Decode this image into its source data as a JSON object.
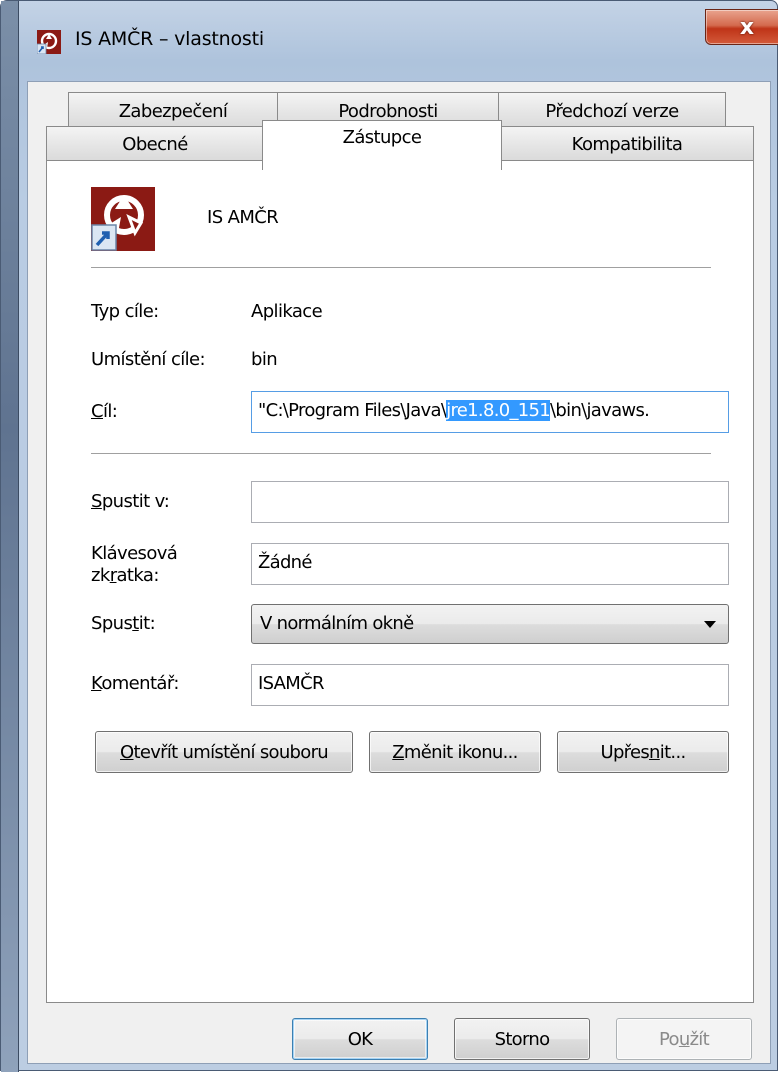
{
  "window": {
    "title": "IS AMČR – vlastnosti",
    "close_label": "x"
  },
  "tabs": {
    "row1": [
      {
        "label": "Zabezpečení"
      },
      {
        "label": "Podrobnosti"
      },
      {
        "label": "Předchozí verze"
      }
    ],
    "row2": [
      {
        "label": "Obecné"
      },
      {
        "label": "Zástupce",
        "active": true
      },
      {
        "label": "Kompatibilita"
      }
    ]
  },
  "shortcut": {
    "app_name": "IS AMČR",
    "icon": "app-shortcut-icon",
    "target_type_label": "Typ cíle:",
    "target_type_value": "Aplikace",
    "target_location_label": "Umístění cíle:",
    "target_location_value": "bin",
    "target_label": "Cíl:",
    "target_value_prefix": "\"C:\\Program Files\\Java\\",
    "target_value_selected": "jre1.8.0_151",
    "target_value_suffix": "\\bin\\javaws.",
    "start_in_label": "Spustit v:",
    "start_in_value": "",
    "hotkey_label_line1": "Klávesová",
    "hotkey_label_line2": "zkratka:",
    "hotkey_value": "Žádné",
    "run_label": "Spustit:",
    "run_value": "V normálním okně",
    "comment_label": "Komentář:",
    "comment_value": "ISAMČR"
  },
  "buttons": {
    "open_location": "Otevřít umístění souboru",
    "change_icon": "Změnit ikonu...",
    "advanced": "Upřesnit...",
    "ok": "OK",
    "cancel": "Storno",
    "apply": "Použít"
  },
  "colors": {
    "selection": "#3399ff",
    "close_button": "#c94a2b",
    "icon_red": "#8b1a14"
  }
}
